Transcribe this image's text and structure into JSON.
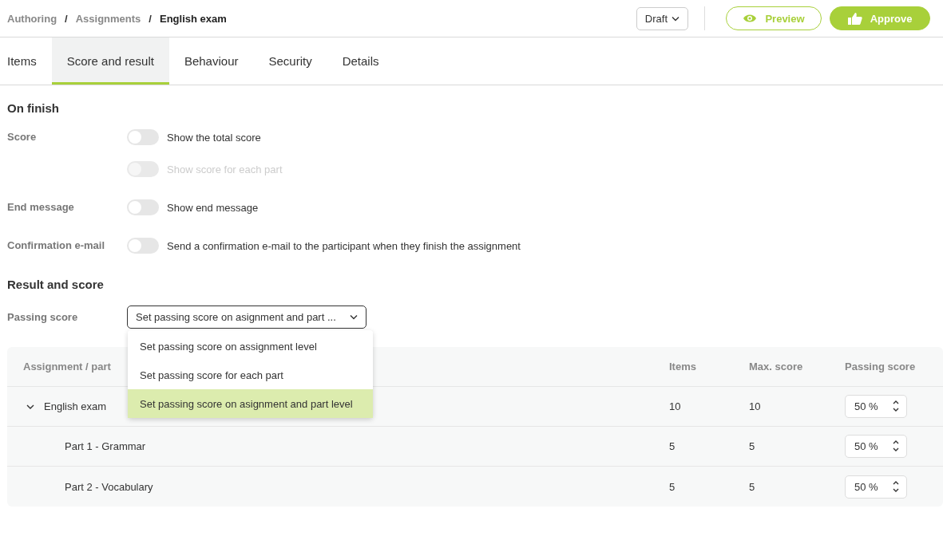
{
  "breadcrumb": [
    {
      "label": "Authoring",
      "current": false
    },
    {
      "label": "Assignments",
      "current": false
    },
    {
      "label": "English exam",
      "current": true
    }
  ],
  "breadcrumb_separator": "/",
  "status_dropdown": {
    "value": "Draft"
  },
  "actions": [
    {
      "label": "Preview",
      "kind": "outline"
    },
    {
      "label": "Approve",
      "kind": "primary"
    }
  ],
  "tabs": [
    {
      "label": "Items",
      "selected": false
    },
    {
      "label": "Score and result",
      "selected": true
    },
    {
      "label": "Behaviour",
      "selected": false
    },
    {
      "label": "Security",
      "selected": false
    },
    {
      "label": "Details",
      "selected": false
    }
  ],
  "on_finish": {
    "title": "On finish",
    "settings": [
      {
        "label": "Score",
        "toggles": [
          {
            "text": "Show the total score",
            "on": false,
            "disabled": false
          },
          {
            "text": "Show score for each part",
            "on": false,
            "disabled": true
          }
        ]
      },
      {
        "label": "End message",
        "toggles": [
          {
            "text": "Show end message",
            "on": false,
            "disabled": false
          }
        ]
      },
      {
        "label": "Confirmation e-mail",
        "toggles": [
          {
            "text": "Send a confirmation e-mail to the participant when they finish the assignment",
            "on": false,
            "disabled": false
          }
        ]
      }
    ]
  },
  "result_and_score": {
    "title": "Result and score",
    "passing_score": {
      "label": "Passing score",
      "value": "Set passing score on asignment and part ...",
      "open": true,
      "options": [
        {
          "label": "Set passing score on assignment level",
          "selected": false
        },
        {
          "label": "Set passing score for each part",
          "selected": false
        },
        {
          "label": "Set passing score on asignment and part level",
          "selected": true
        }
      ]
    }
  },
  "table": {
    "columns": [
      "Assignment / part",
      "Items",
      "Max. score",
      "Passing score"
    ],
    "rows": [
      {
        "name": "English exam",
        "items": "10",
        "max_score": "10",
        "passing_score": "50 %",
        "expanded": true,
        "children": [
          {
            "name": "Part 1 - Grammar",
            "items": "5",
            "max_score": "5",
            "passing_score": "50 %"
          },
          {
            "name": "Part 2 - Vocabulary",
            "items": "5",
            "max_score": "5",
            "passing_score": "50 %"
          }
        ]
      }
    ]
  }
}
